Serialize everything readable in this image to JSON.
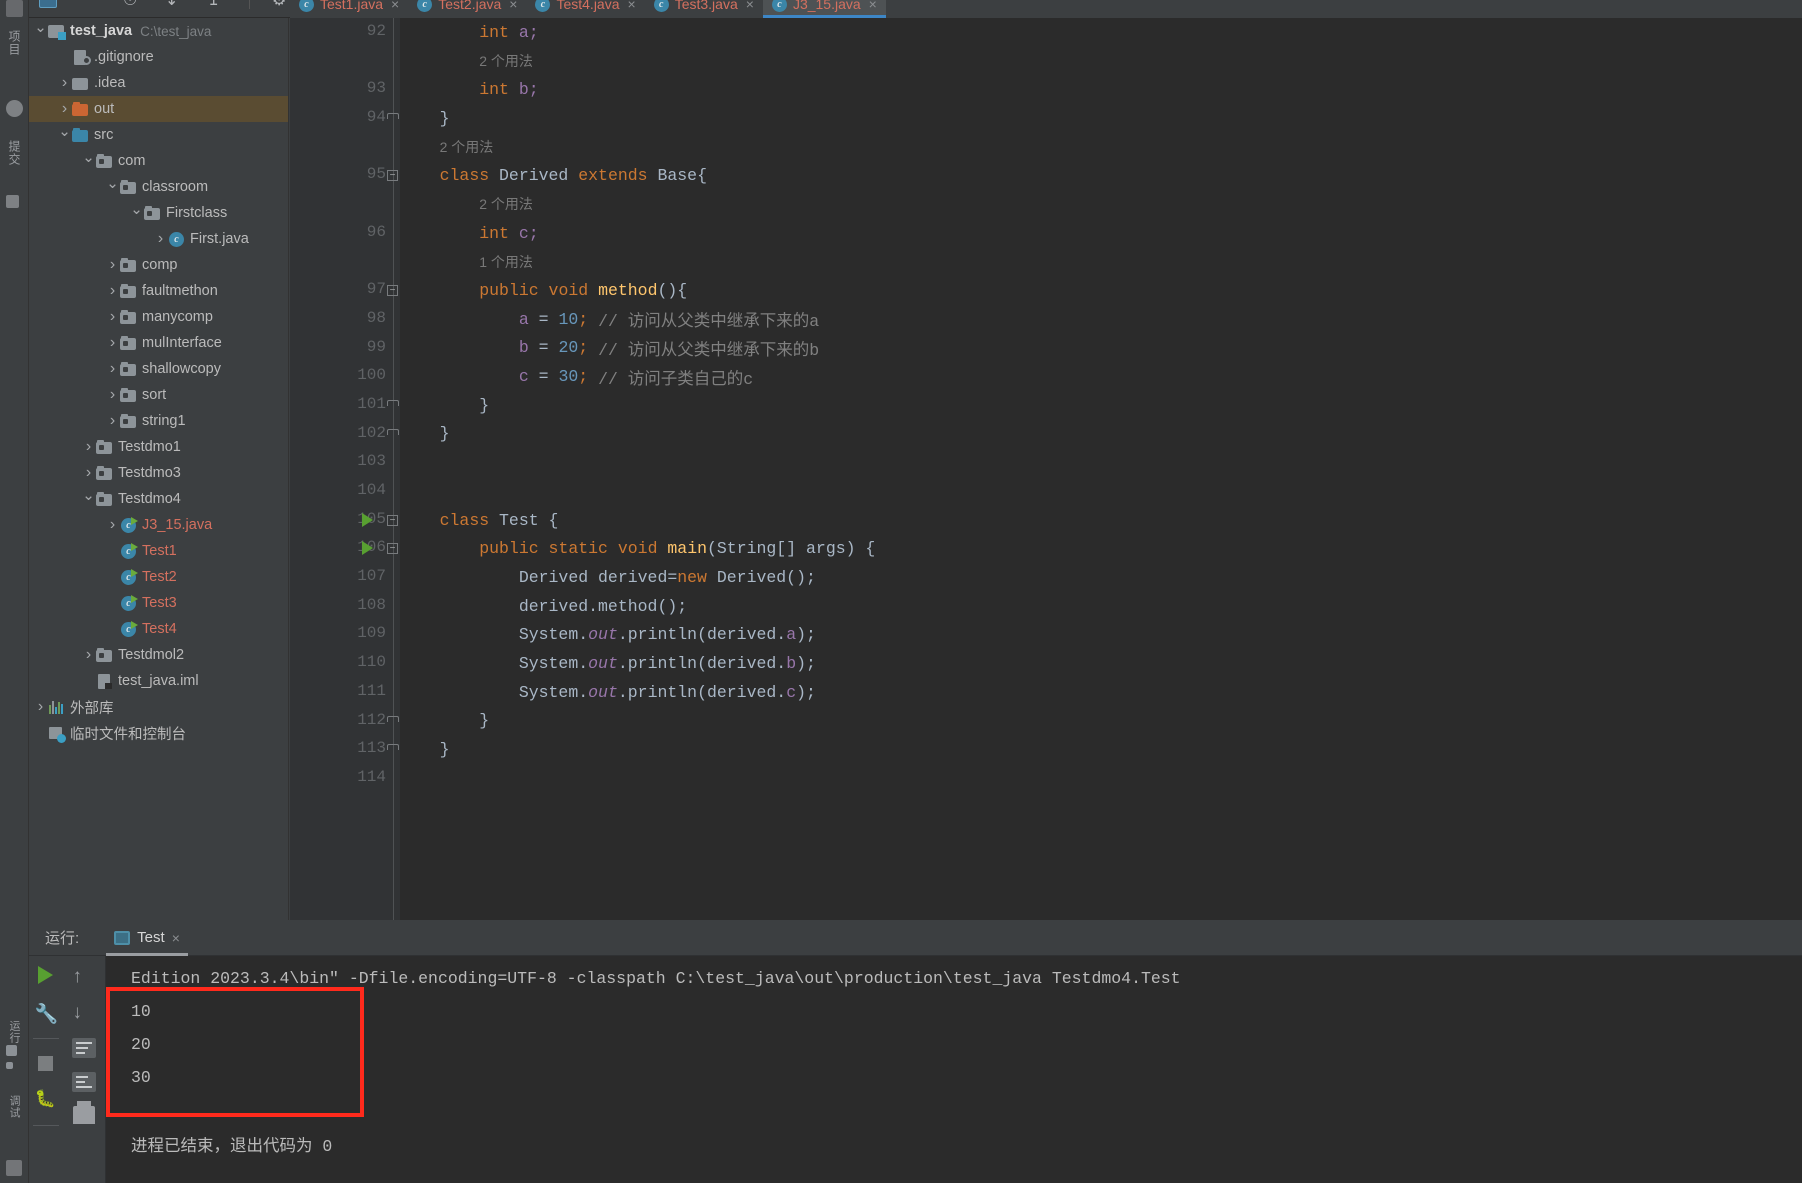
{
  "toolbar": {
    "icons": [
      "window-icon",
      "more-icon",
      "vcs-icon",
      "pull-icon",
      "push-icon",
      "settings-icon",
      "minimize-icon"
    ]
  },
  "left_strip": {
    "labels": [
      "项目",
      "提交",
      "运行",
      "调试"
    ]
  },
  "tree": [
    {
      "indent": 0,
      "arrow": "down",
      "icon": "project",
      "label": "test_java",
      "path": "C:\\test_java",
      "bold": true,
      "selected": false
    },
    {
      "indent": 1,
      "arrow": "none",
      "icon": "gitignore",
      "label": ".gitignore",
      "selected": false
    },
    {
      "indent": 1,
      "arrow": "right",
      "icon": "folder",
      "label": ".idea",
      "selected": false
    },
    {
      "indent": 1,
      "arrow": "right",
      "icon": "folder-orange",
      "label": "out",
      "selected": true
    },
    {
      "indent": 1,
      "arrow": "down",
      "icon": "folder-blue",
      "label": "src",
      "selected": false
    },
    {
      "indent": 2,
      "arrow": "down",
      "icon": "package",
      "label": "com",
      "selected": false
    },
    {
      "indent": 3,
      "arrow": "down",
      "icon": "package",
      "label": "classroom",
      "selected": false
    },
    {
      "indent": 4,
      "arrow": "down",
      "icon": "package",
      "label": "Firstclass",
      "selected": false
    },
    {
      "indent": 5,
      "arrow": "right",
      "icon": "javaclass",
      "label": "First.java",
      "selected": false
    },
    {
      "indent": 3,
      "arrow": "right",
      "icon": "package",
      "label": "comp",
      "selected": false
    },
    {
      "indent": 3,
      "arrow": "right",
      "icon": "package",
      "label": "faultmethon",
      "selected": false
    },
    {
      "indent": 3,
      "arrow": "right",
      "icon": "package",
      "label": "manycomp",
      "selected": false
    },
    {
      "indent": 3,
      "arrow": "right",
      "icon": "package",
      "label": "mulInterface",
      "selected": false
    },
    {
      "indent": 3,
      "arrow": "right",
      "icon": "package",
      "label": "shallowcopy",
      "selected": false
    },
    {
      "indent": 3,
      "arrow": "right",
      "icon": "package",
      "label": "sort",
      "selected": false
    },
    {
      "indent": 3,
      "arrow": "right",
      "icon": "package",
      "label": "string1",
      "selected": false
    },
    {
      "indent": 2,
      "arrow": "right",
      "icon": "package",
      "label": "Testdmo1",
      "selected": false
    },
    {
      "indent": 2,
      "arrow": "right",
      "icon": "package",
      "label": "Testdmo3",
      "selected": false
    },
    {
      "indent": 2,
      "arrow": "down",
      "icon": "package",
      "label": "Testdmo4",
      "selected": false
    },
    {
      "indent": 3,
      "arrow": "right",
      "icon": "javaclass-run",
      "label": "J3_15.java",
      "red": true,
      "selected": false
    },
    {
      "indent": 3,
      "arrow": "none",
      "icon": "javaclass-run",
      "label": "Test1",
      "red": true,
      "selected": false
    },
    {
      "indent": 3,
      "arrow": "none",
      "icon": "javaclass-run",
      "label": "Test2",
      "red": true,
      "selected": false
    },
    {
      "indent": 3,
      "arrow": "none",
      "icon": "javaclass-run",
      "label": "Test3",
      "red": true,
      "selected": false
    },
    {
      "indent": 3,
      "arrow": "none",
      "icon": "javaclass-run",
      "label": "Test4",
      "red": true,
      "selected": false
    },
    {
      "indent": 2,
      "arrow": "right",
      "icon": "package",
      "label": "Testdmol2",
      "selected": false
    },
    {
      "indent": 2,
      "arrow": "none",
      "icon": "iml",
      "label": "test_java.iml",
      "selected": false
    },
    {
      "indent": 0,
      "arrow": "right",
      "icon": "library",
      "label": "外部库",
      "selected": false
    },
    {
      "indent": 0,
      "arrow": "none",
      "icon": "scratch",
      "label": "临时文件和控制台",
      "selected": false
    }
  ],
  "editor": {
    "tabs": [
      {
        "label": "Test1.java",
        "active": false
      },
      {
        "label": "Test2.java",
        "active": false
      },
      {
        "label": "Test4.java",
        "active": false
      },
      {
        "label": "Test3.java",
        "active": false
      },
      {
        "label": "J3_15.java",
        "active": true
      }
    ],
    "close_glyph": "×",
    "lines": [
      {
        "num": "92",
        "fold": "",
        "run": false,
        "tokens": [
          {
            "t": "        ",
            "c": "t"
          },
          {
            "t": "int",
            "c": "k"
          },
          {
            "t": " a;",
            "c": "v"
          }
        ]
      },
      {
        "num": "",
        "hint": "2 个用法",
        "indent": "        "
      },
      {
        "num": "93",
        "fold": "",
        "run": false,
        "tokens": [
          {
            "t": "        ",
            "c": "t"
          },
          {
            "t": "int",
            "c": "k"
          },
          {
            "t": " b;",
            "c": "v"
          }
        ]
      },
      {
        "num": "94",
        "fold": "end",
        "run": false,
        "tokens": [
          {
            "t": "    }",
            "c": "t"
          }
        ]
      },
      {
        "num": "",
        "hint": "2 个用法",
        "indent": "    "
      },
      {
        "num": "95",
        "fold": "open",
        "run": false,
        "tokens": [
          {
            "t": "    ",
            "c": "t"
          },
          {
            "t": "class",
            "c": "k"
          },
          {
            "t": " Derived ",
            "c": "t"
          },
          {
            "t": "extends",
            "c": "k"
          },
          {
            "t": " Base{",
            "c": "t"
          }
        ]
      },
      {
        "num": "",
        "hint": "2 个用法",
        "indent": "        "
      },
      {
        "num": "96",
        "fold": "",
        "run": false,
        "tokens": [
          {
            "t": "        ",
            "c": "t"
          },
          {
            "t": "int",
            "c": "k"
          },
          {
            "t": " c;",
            "c": "v"
          }
        ]
      },
      {
        "num": "",
        "hint": "1 个用法",
        "indent": "        "
      },
      {
        "num": "97",
        "fold": "open",
        "run": false,
        "tokens": [
          {
            "t": "        ",
            "c": "t"
          },
          {
            "t": "public",
            "c": "k"
          },
          {
            "t": " ",
            "c": "t"
          },
          {
            "t": "void",
            "c": "k"
          },
          {
            "t": " ",
            "c": "t"
          },
          {
            "t": "method",
            "c": "m"
          },
          {
            "t": "(){",
            "c": "t"
          }
        ]
      },
      {
        "num": "98",
        "fold": "",
        "run": false,
        "tokens": [
          {
            "t": "            ",
            "c": "t"
          },
          {
            "t": "a",
            "c": "v"
          },
          {
            "t": " = ",
            "c": "t"
          },
          {
            "t": "10",
            "c": "n"
          },
          {
            "t": ";",
            "c": "k"
          },
          {
            "t": " // 访问从父类中继承下来的a",
            "c": "c"
          }
        ]
      },
      {
        "num": "99",
        "fold": "",
        "run": false,
        "tokens": [
          {
            "t": "            ",
            "c": "t"
          },
          {
            "t": "b",
            "c": "v"
          },
          {
            "t": " = ",
            "c": "t"
          },
          {
            "t": "20",
            "c": "n"
          },
          {
            "t": ";",
            "c": "k"
          },
          {
            "t": " // 访问从父类中继承下来的b",
            "c": "c"
          }
        ]
      },
      {
        "num": "100",
        "fold": "",
        "run": false,
        "tokens": [
          {
            "t": "            ",
            "c": "t"
          },
          {
            "t": "c",
            "c": "v"
          },
          {
            "t": " = ",
            "c": "t"
          },
          {
            "t": "30",
            "c": "n"
          },
          {
            "t": ";",
            "c": "k"
          },
          {
            "t": " // 访问子类自己的c",
            "c": "c"
          }
        ]
      },
      {
        "num": "101",
        "fold": "end",
        "run": false,
        "tokens": [
          {
            "t": "        }",
            "c": "t"
          }
        ]
      },
      {
        "num": "102",
        "fold": "end",
        "run": false,
        "tokens": [
          {
            "t": "    }",
            "c": "t"
          }
        ]
      },
      {
        "num": "103",
        "fold": "",
        "run": false,
        "tokens": []
      },
      {
        "num": "104",
        "fold": "",
        "run": false,
        "tokens": []
      },
      {
        "num": "105",
        "fold": "open",
        "run": true,
        "tokens": [
          {
            "t": "    ",
            "c": "t"
          },
          {
            "t": "class",
            "c": "k"
          },
          {
            "t": " Test {",
            "c": "t"
          }
        ]
      },
      {
        "num": "106",
        "fold": "open",
        "run": true,
        "tokens": [
          {
            "t": "        ",
            "c": "t"
          },
          {
            "t": "public",
            "c": "k"
          },
          {
            "t": " ",
            "c": "t"
          },
          {
            "t": "static",
            "c": "k"
          },
          {
            "t": " ",
            "c": "t"
          },
          {
            "t": "void",
            "c": "k"
          },
          {
            "t": " ",
            "c": "t"
          },
          {
            "t": "main",
            "c": "m"
          },
          {
            "t": "(String[] args) {",
            "c": "t"
          }
        ]
      },
      {
        "num": "107",
        "fold": "",
        "run": false,
        "tokens": [
          {
            "t": "            Derived derived=",
            "c": "t"
          },
          {
            "t": "new",
            "c": "k"
          },
          {
            "t": " Derived();",
            "c": "t"
          }
        ]
      },
      {
        "num": "108",
        "fold": "",
        "run": false,
        "tokens": [
          {
            "t": "            derived.method();",
            "c": "t"
          }
        ]
      },
      {
        "num": "109",
        "fold": "",
        "run": false,
        "tokens": [
          {
            "t": "            System.",
            "c": "t"
          },
          {
            "t": "out",
            "c": "sv"
          },
          {
            "t": ".println(derived.",
            "c": "t"
          },
          {
            "t": "a",
            "c": "v"
          },
          {
            "t": ");",
            "c": "t"
          }
        ]
      },
      {
        "num": "110",
        "fold": "",
        "run": false,
        "tokens": [
          {
            "t": "            System.",
            "c": "t"
          },
          {
            "t": "out",
            "c": "sv"
          },
          {
            "t": ".println(derived.",
            "c": "t"
          },
          {
            "t": "b",
            "c": "v"
          },
          {
            "t": ");",
            "c": "t"
          }
        ]
      },
      {
        "num": "111",
        "fold": "",
        "run": false,
        "tokens": [
          {
            "t": "            System.",
            "c": "t"
          },
          {
            "t": "out",
            "c": "sv"
          },
          {
            "t": ".println(derived.",
            "c": "t"
          },
          {
            "t": "c",
            "c": "v"
          },
          {
            "t": ");",
            "c": "t"
          }
        ]
      },
      {
        "num": "112",
        "fold": "end",
        "run": false,
        "tokens": [
          {
            "t": "        }",
            "c": "t"
          }
        ]
      },
      {
        "num": "113",
        "fold": "end",
        "run": false,
        "tokens": [
          {
            "t": "    }",
            "c": "t"
          }
        ]
      },
      {
        "num": "114",
        "fold": "",
        "run": false,
        "tokens": []
      }
    ]
  },
  "run_panel": {
    "title": "运行:",
    "tab_label": "Test",
    "tab_close": "×",
    "tool_icons": [
      "run-icon",
      "wrench-icon",
      "stop-icon",
      "debug-icon",
      "arrow-up-icon",
      "arrow-down-icon",
      "soft-wrap-icon",
      "scroll-to-end-icon",
      "print-icon"
    ],
    "console_lines": [
      "Edition 2023.3.4\\bin\" -Dfile.encoding=UTF-8 -classpath C:\\test_java\\out\\production\\test_java Testdmo4.Test",
      "10",
      "20",
      "30",
      "",
      "进程已结束，退出代码为 0"
    ],
    "highlight_color": "#ff2a1c"
  }
}
